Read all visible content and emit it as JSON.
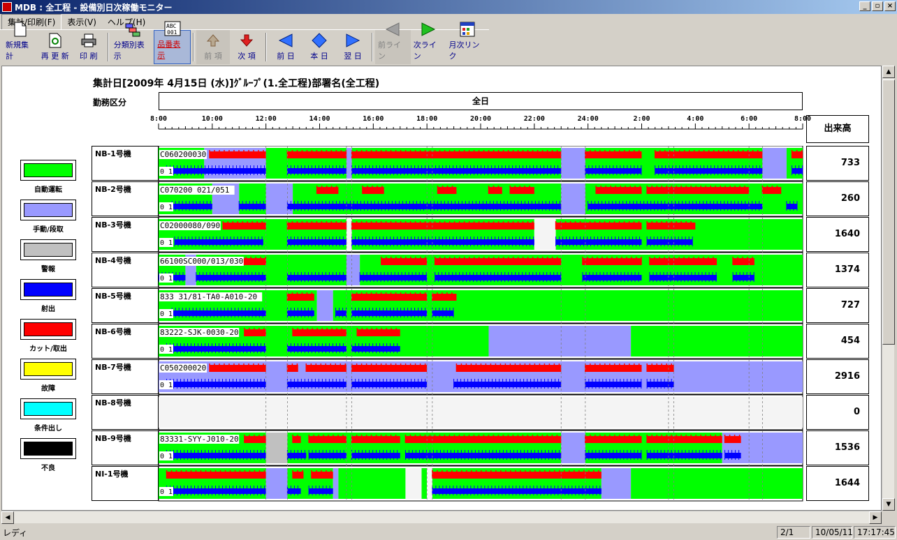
{
  "window": {
    "title": "MDB : 全工程 - 設備別日次稼働モニター",
    "minimize": "_",
    "restore": "▫",
    "close": "×"
  },
  "menu": [
    {
      "label": "集計/印刷(F)"
    },
    {
      "label": "表示(V)"
    },
    {
      "label": "ヘルプ(H)"
    }
  ],
  "toolbar": {
    "new": "新規集計",
    "refresh": "再 更 新",
    "print": "印 刷",
    "category": "分類別表示",
    "product": "品番表示",
    "prev_item": "前 項",
    "next_item": "次 項",
    "prev_day": "前 日",
    "today": "本 日",
    "next_day": "翌 日",
    "prev_line": "前ライン",
    "next_line": "次ライン",
    "monthly": "月次リンク"
  },
  "report": {
    "title": "集計日[2009年 4月15日 (水)]ｸﾞﾙｰﾌﾟ(1.全工程)部署名(全工程)",
    "shift_label": "勤務区分",
    "shift_value": "全日",
    "output_header": "出来高"
  },
  "colors": {
    "auto": "#00ff00",
    "manual": "#9999ff",
    "alarm": "#c0c0c0",
    "shot": "#0000ff",
    "cut": "#ff0000",
    "fault": "#ffff00",
    "condition": "#00ffff",
    "defect": "#000000",
    "idle": "#f4f4f4"
  },
  "legend": [
    {
      "label": "自動運転",
      "color": "#00ff00"
    },
    {
      "label": "手動/段取",
      "color": "#9999ff"
    },
    {
      "label": "警報",
      "color": "#c0c0c0"
    },
    {
      "label": "射出",
      "color": "#0000ff"
    },
    {
      "label": "カット/取出",
      "color": "#ff0000"
    },
    {
      "label": "故障",
      "color": "#ffff00"
    },
    {
      "label": "条件出し",
      "color": "#00ffff"
    },
    {
      "label": "不良",
      "color": "#000000"
    }
  ],
  "time_axis": [
    "8:00",
    "10:00",
    "12:00",
    "14:00",
    "16:00",
    "18:00",
    "20:00",
    "22:00",
    "24:00",
    "2:00",
    "4:00",
    "6:00",
    "8:00"
  ],
  "machines": [
    {
      "name": "NB-1号機",
      "output": "733",
      "product": "C060200030",
      "counter": "0 1",
      "bg": [
        [
          0,
          1.7,
          "auto"
        ],
        [
          1.7,
          4,
          "manual"
        ],
        [
          4,
          7,
          "auto"
        ],
        [
          7,
          7.2,
          "manual"
        ],
        [
          7.2,
          15,
          "auto"
        ],
        [
          15,
          15.9,
          "manual"
        ],
        [
          15.9,
          22.5,
          "auto"
        ],
        [
          22.5,
          23.4,
          "manual"
        ],
        [
          23.4,
          24,
          "auto"
        ]
      ],
      "cut": [
        [
          1.9,
          4
        ],
        [
          4.8,
          7
        ],
        [
          7.2,
          15
        ],
        [
          15.9,
          18
        ],
        [
          18.5,
          22.5
        ],
        [
          23.6,
          24
        ]
      ],
      "shot": [
        [
          0.3,
          4
        ],
        [
          4.8,
          7
        ],
        [
          7.2,
          15
        ],
        [
          15.9,
          18
        ],
        [
          18.5,
          22.5
        ],
        [
          23.6,
          24
        ]
      ]
    },
    {
      "name": "NB-2号機",
      "output": "260",
      "product": "C070200  021/051",
      "counter": "0 1",
      "bg": [
        [
          0,
          2,
          "auto"
        ],
        [
          2,
          3,
          "manual"
        ],
        [
          3,
          4,
          "auto"
        ],
        [
          4,
          5,
          "manual"
        ],
        [
          5,
          15,
          "auto"
        ],
        [
          15,
          15.9,
          "manual"
        ],
        [
          15.9,
          24,
          "auto"
        ]
      ],
      "cut": [
        [
          5.9,
          6.7
        ],
        [
          7.6,
          8.4
        ],
        [
          10.4,
          11.1
        ],
        [
          12.3,
          12.8
        ],
        [
          13.1,
          14
        ],
        [
          16.3,
          18
        ],
        [
          18.2,
          22
        ],
        [
          22.5,
          23.2
        ]
      ],
      "shot": [
        [
          0.5,
          2
        ],
        [
          3,
          4
        ],
        [
          4.8,
          15
        ],
        [
          16,
          22.5
        ],
        [
          23.4,
          23.8
        ]
      ]
    },
    {
      "name": "NB-3号機",
      "output": "1640",
      "product": "C02000080/090",
      "counter": "0 1",
      "bg": [
        [
          0,
          7,
          "auto"
        ],
        [
          7,
          7.2,
          "idle"
        ],
        [
          7.2,
          14,
          "auto"
        ],
        [
          14,
          14.8,
          "idle"
        ],
        [
          14.8,
          24,
          "auto"
        ]
      ],
      "cut": [
        [
          2.4,
          4
        ],
        [
          4.8,
          7
        ],
        [
          7.2,
          14
        ],
        [
          14.8,
          18
        ],
        [
          18.2,
          20
        ]
      ],
      "shot": [
        [
          0.6,
          3.9
        ],
        [
          4.8,
          7
        ],
        [
          7.2,
          14
        ],
        [
          14.8,
          18
        ],
        [
          18.2,
          19.9
        ]
      ]
    },
    {
      "name": "NB-4号機",
      "output": "1374",
      "product": "66100SC000/013/030",
      "counter": "0 1",
      "bg": [
        [
          0,
          1,
          "auto"
        ],
        [
          1,
          1.4,
          "manual"
        ],
        [
          1.4,
          7,
          "auto"
        ],
        [
          7,
          7.5,
          "manual"
        ],
        [
          7.5,
          24,
          "auto"
        ]
      ],
      "cut": [
        [
          0.2,
          1
        ],
        [
          1.8,
          4
        ],
        [
          8.3,
          10
        ],
        [
          10.3,
          15
        ],
        [
          15.8,
          18
        ],
        [
          18.3,
          20.8
        ],
        [
          21.4,
          22.2
        ]
      ],
      "shot": [
        [
          0,
          1
        ],
        [
          1.4,
          4
        ],
        [
          4.8,
          7
        ],
        [
          7.5,
          10
        ],
        [
          10.3,
          15
        ],
        [
          15.8,
          18
        ],
        [
          18.3,
          20.8
        ],
        [
          21.4,
          22.2
        ]
      ]
    },
    {
      "name": "NB-5号機",
      "output": "727",
      "product": "833  31/81-TA0-A010-20",
      "counter": "0 1",
      "bg": [
        [
          0,
          5.9,
          "auto"
        ],
        [
          5.9,
          6.5,
          "manual"
        ],
        [
          6.5,
          24,
          "auto"
        ]
      ],
      "cut": [
        [
          4.8,
          5.8
        ],
        [
          7.2,
          10
        ],
        [
          10.2,
          11.1
        ]
      ],
      "shot": [
        [
          0.5,
          4
        ],
        [
          4.8,
          5.8
        ],
        [
          6.6,
          7
        ],
        [
          7.2,
          10
        ],
        [
          10.2,
          11
        ]
      ]
    },
    {
      "name": "NB-6号機",
      "output": "454",
      "product": "83222-SJK-0030-20",
      "counter": "0 1",
      "bg": [
        [
          0,
          12.3,
          "auto"
        ],
        [
          12.3,
          17.6,
          "manual"
        ],
        [
          17.6,
          24,
          "auto"
        ]
      ],
      "cut": [
        [
          3.2,
          4
        ],
        [
          5.0,
          7
        ],
        [
          7.4,
          9
        ]
      ],
      "shot": [
        [
          0.3,
          4
        ],
        [
          4.8,
          7
        ],
        [
          7.2,
          9
        ]
      ]
    },
    {
      "name": "NB-7号機",
      "output": "2916",
      "product": "C050200020",
      "counter": "0 1",
      "bg": [
        [
          0,
          24,
          "manual"
        ]
      ],
      "cut": [
        [
          1.9,
          4
        ],
        [
          4.8,
          5.2
        ],
        [
          5.5,
          7
        ],
        [
          7.2,
          10
        ],
        [
          11.1,
          15
        ],
        [
          15.9,
          18
        ],
        [
          18.2,
          19.2
        ]
      ],
      "shot": [
        [
          0.3,
          4
        ],
        [
          4.8,
          7
        ],
        [
          7.2,
          10
        ],
        [
          11,
          15
        ],
        [
          15.9,
          18
        ],
        [
          18.2,
          19.2
        ]
      ]
    },
    {
      "name": "NB-8号機",
      "output": "0",
      "product": "",
      "counter": "",
      "bg": [
        [
          0,
          24,
          "idle"
        ]
      ],
      "cut": [],
      "shot": []
    },
    {
      "name": "NB-9号機",
      "output": "1536",
      "product": "83331-SYY-J010-20",
      "counter": "0 1",
      "bg": [
        [
          0,
          4,
          "auto"
        ],
        [
          4,
          4.8,
          "alarm"
        ],
        [
          4.8,
          15,
          "auto"
        ],
        [
          15,
          15.9,
          "manual"
        ],
        [
          15.9,
          21,
          "auto"
        ],
        [
          21,
          24,
          "manual"
        ]
      ],
      "cut": [
        [
          3.2,
          4
        ],
        [
          5,
          5.3
        ],
        [
          5.6,
          7
        ],
        [
          7.2,
          9
        ],
        [
          9.2,
          15
        ],
        [
          15.9,
          18
        ],
        [
          18.2,
          21
        ],
        [
          21.1,
          21.7
        ]
      ],
      "shot": [
        [
          0.3,
          4
        ],
        [
          4.8,
          5.5
        ],
        [
          5.6,
          7
        ],
        [
          7.2,
          9
        ],
        [
          9.2,
          15
        ],
        [
          15.9,
          18
        ],
        [
          18.2,
          21
        ],
        [
          21.1,
          21.7
        ]
      ]
    },
    {
      "name": "NI-1号機",
      "output": "1644",
      "product": "",
      "counter": "0 1",
      "bg": [
        [
          0,
          4,
          "auto"
        ],
        [
          4,
          4.8,
          "manual"
        ],
        [
          4.8,
          6.5,
          "auto"
        ],
        [
          6.5,
          6.7,
          "manual"
        ],
        [
          6.7,
          9.2,
          "auto"
        ],
        [
          9.2,
          9.8,
          "idle"
        ],
        [
          9.8,
          10,
          "auto"
        ],
        [
          10,
          10.2,
          "idle"
        ],
        [
          10.2,
          16.5,
          "auto"
        ],
        [
          16.5,
          17.6,
          "manual"
        ],
        [
          17.6,
          24,
          "auto"
        ]
      ],
      "cut": [
        [
          0.3,
          4
        ],
        [
          5,
          5.4
        ],
        [
          5.7,
          6.5
        ],
        [
          10.2,
          16.5
        ]
      ],
      "shot": [
        [
          0.3,
          4
        ],
        [
          4.8,
          5.3
        ],
        [
          5.6,
          6.5
        ],
        [
          10.2,
          16.5
        ]
      ]
    }
  ],
  "status": {
    "ready": "レディ",
    "page": "2/1",
    "date": "10/05/11",
    "time": "17:17:45"
  }
}
